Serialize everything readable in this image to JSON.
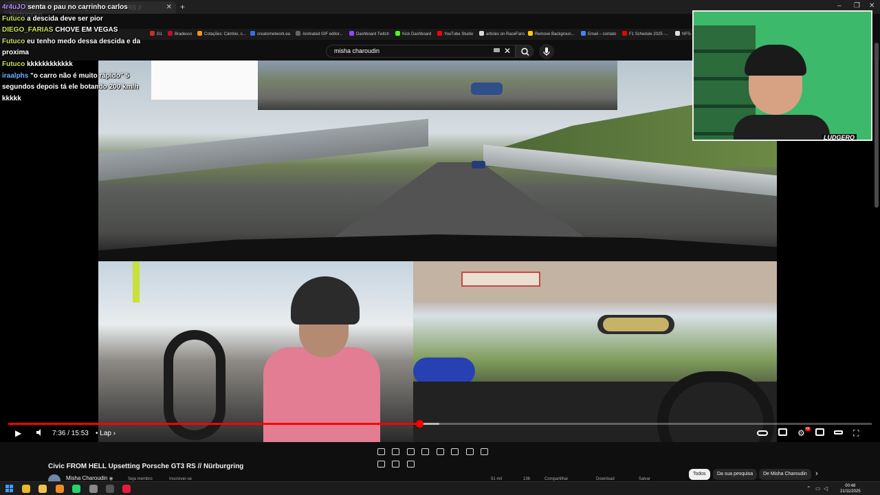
{
  "browser": {
    "tab_title": "Civic FROM HELL Upsetting Porsche GT3 RS // Nürburgring",
    "tab_close": "✕",
    "new_tab": "+",
    "bookmarks": [
      {
        "label": "G1",
        "color": "#c4302b"
      },
      {
        "label": "Bradesco",
        "color": "#cc092f"
      },
      {
        "label": "Cotações: Câmbio, c...",
        "color": "#f7931a"
      },
      {
        "label": "creatornetwork.ea",
        "color": "#3a6ee8"
      },
      {
        "label": "Animated GIF editor...",
        "color": "#666666"
      },
      {
        "label": "Dashboard Twitch",
        "color": "#9146ff"
      },
      {
        "label": "Kick Dashboard",
        "color": "#53fc18"
      },
      {
        "label": "YouTube Studio",
        "color": "#ff0000"
      },
      {
        "label": "articles on RaceFans",
        "color": "#d9d9d9"
      },
      {
        "label": "Remove Backgroun...",
        "color": "#ffcc00"
      },
      {
        "label": "Email – contato",
        "color": "#4285f4"
      },
      {
        "label": "F1 Schedule 2025 -...",
        "color": "#e10600"
      },
      {
        "label": "NFS-",
        "color": "#dddddd"
      }
    ]
  },
  "search": {
    "query": "misha charoudin",
    "clear": "✕",
    "search_icon": "⚲",
    "mic_icon": "🎙"
  },
  "chat": [
    {
      "user": "4r4uJO",
      "text": "senta o pau no carrinho carlos",
      "color": "purple"
    },
    {
      "user": "Futuco",
      "text": "a descida deve ser pior",
      "color": "green"
    },
    {
      "user": "DIEGO_FARIAS",
      "text": "CHOVE EM VEGAS",
      "color": "green"
    },
    {
      "user": "Futuco",
      "text": "eu tenho medo dessa descida e da proxima",
      "color": "green"
    },
    {
      "user": "Futuco",
      "text": "kkkkkkkkkkkk",
      "color": "green"
    },
    {
      "user": "iraalphs",
      "text": "\"o carro não é muito rápido\" 5 segundos depois tá ele botando 200 km/h kkkkk",
      "color": "blue"
    }
  ],
  "webcam": {
    "logo": "LUDGERO"
  },
  "player": {
    "progress": 0.476,
    "play_icon": "▶",
    "volume_icon": "🔈",
    "time": "7:36 / 15:53",
    "chapter": "• Lap ›",
    "hd": "4K"
  },
  "video": {
    "title": "Civic FROM HELL Upsetting Porsche GT3 RS // Nürburgring",
    "channel": "Misha Charoudin",
    "verified": "◉",
    "actions": [
      "Seja membro",
      "Inscrever-se",
      "51 mil",
      "136",
      "Compartilhar",
      "Download",
      "Salvar"
    ]
  },
  "chips": [
    {
      "label": "Todos",
      "active": true
    },
    {
      "label": "Da sua pesquisa",
      "active": false
    },
    {
      "label": "De Misha Charoudin",
      "active": false
    }
  ],
  "chips_next": "›",
  "taskbar": {
    "time": "00:48",
    "date": "21/11/2025",
    "icons": [
      {
        "name": "chrome",
        "color": "#e8b92c"
      },
      {
        "name": "files",
        "color": "#f0c24a"
      },
      {
        "name": "app-orange",
        "color": "#f08a24"
      },
      {
        "name": "whatsapp",
        "color": "#25d366"
      },
      {
        "name": "app-gray",
        "color": "#888888"
      },
      {
        "name": "obs",
        "color": "#555555"
      },
      {
        "name": "app-red",
        "color": "#e81a3b"
      }
    ]
  }
}
